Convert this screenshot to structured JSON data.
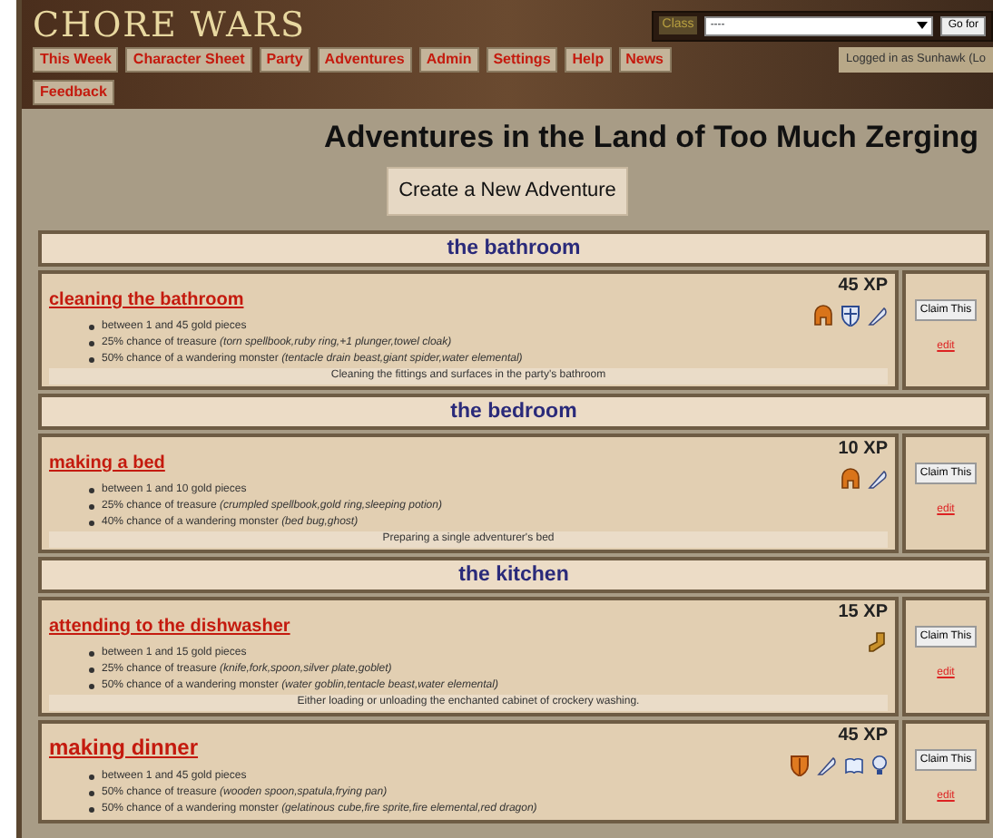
{
  "header": {
    "logo": "CHORE WARS",
    "class_label": "Class",
    "class_value": "----",
    "go_button": "Go for",
    "login": "Logged in as Sunhawk (Lo"
  },
  "nav": [
    {
      "label": "This Week"
    },
    {
      "label": "Character Sheet"
    },
    {
      "label": "Party"
    },
    {
      "label": "Adventures"
    },
    {
      "label": "Admin"
    },
    {
      "label": "Settings"
    },
    {
      "label": "Help"
    },
    {
      "label": "News"
    },
    {
      "label": "Feedback"
    }
  ],
  "title": "Adventures in the Land of Too Much Zerging",
  "create_button": "Create a New Adventure",
  "sections": [
    {
      "room": "the bathroom",
      "adventures": [
        {
          "title": "cleaning the bathroom",
          "xp": "45 XP",
          "bullets": [
            "between 1 and 45 gold pieces",
            "25% chance of treasure *(torn spellbook,ruby ring,+1 plunger,towel cloak)*",
            "50% chance of a wandering monster *(tentacle drain beast,giant spider,water elemental)*"
          ],
          "description": "Cleaning the fittings and surfaces in the party's bathroom",
          "icons": [
            {
              "kind": "helmet"
            },
            {
              "kind": "shield"
            },
            {
              "kind": "quill"
            }
          ],
          "claim": "Claim This",
          "edit": "edit"
        }
      ]
    },
    {
      "room": "the bedroom",
      "adventures": [
        {
          "title": "making a bed",
          "xp": "10 XP",
          "bullets": [
            "between 1 and 10 gold pieces",
            "25% chance of treasure *(crumpled spellbook,gold ring,sleeping potion)*",
            "40% chance of a wandering monster *(bed bug,ghost)*"
          ],
          "description": "Preparing a single adventurer's bed",
          "icons": [
            {
              "kind": "helmet"
            },
            {
              "kind": "quill"
            }
          ],
          "claim": "Claim This",
          "edit": "edit"
        }
      ]
    },
    {
      "room": "the kitchen",
      "adventures": [
        {
          "title": "attending to the dishwasher",
          "xp": "15 XP",
          "bullets": [
            "between 1 and 15 gold pieces",
            "25% chance of treasure *(knife,fork,spoon,silver plate,goblet)*",
            "50% chance of a wandering monster *(water goblin,tentacle beast,water elemental)*"
          ],
          "description": "Either loading or unloading the enchanted cabinet of crockery washing.",
          "icons": [
            {
              "kind": "boot"
            }
          ],
          "claim": "Claim This",
          "edit": "edit"
        },
        {
          "title": "making dinner",
          "xp": "45 XP",
          "bullets": [
            "between 1 and 45 gold pieces",
            "50% chance of treasure *(wooden spoon,spatula,frying pan)*",
            "50% chance of a wandering monster *(gelatinous cube,fire sprite,fire elemental,red dragon)*"
          ],
          "icons": [
            {
              "kind": "shield-orange"
            },
            {
              "kind": "quill"
            },
            {
              "kind": "book"
            },
            {
              "kind": "bulb"
            }
          ],
          "claim": "Claim This",
          "edit": "edit"
        }
      ]
    }
  ]
}
